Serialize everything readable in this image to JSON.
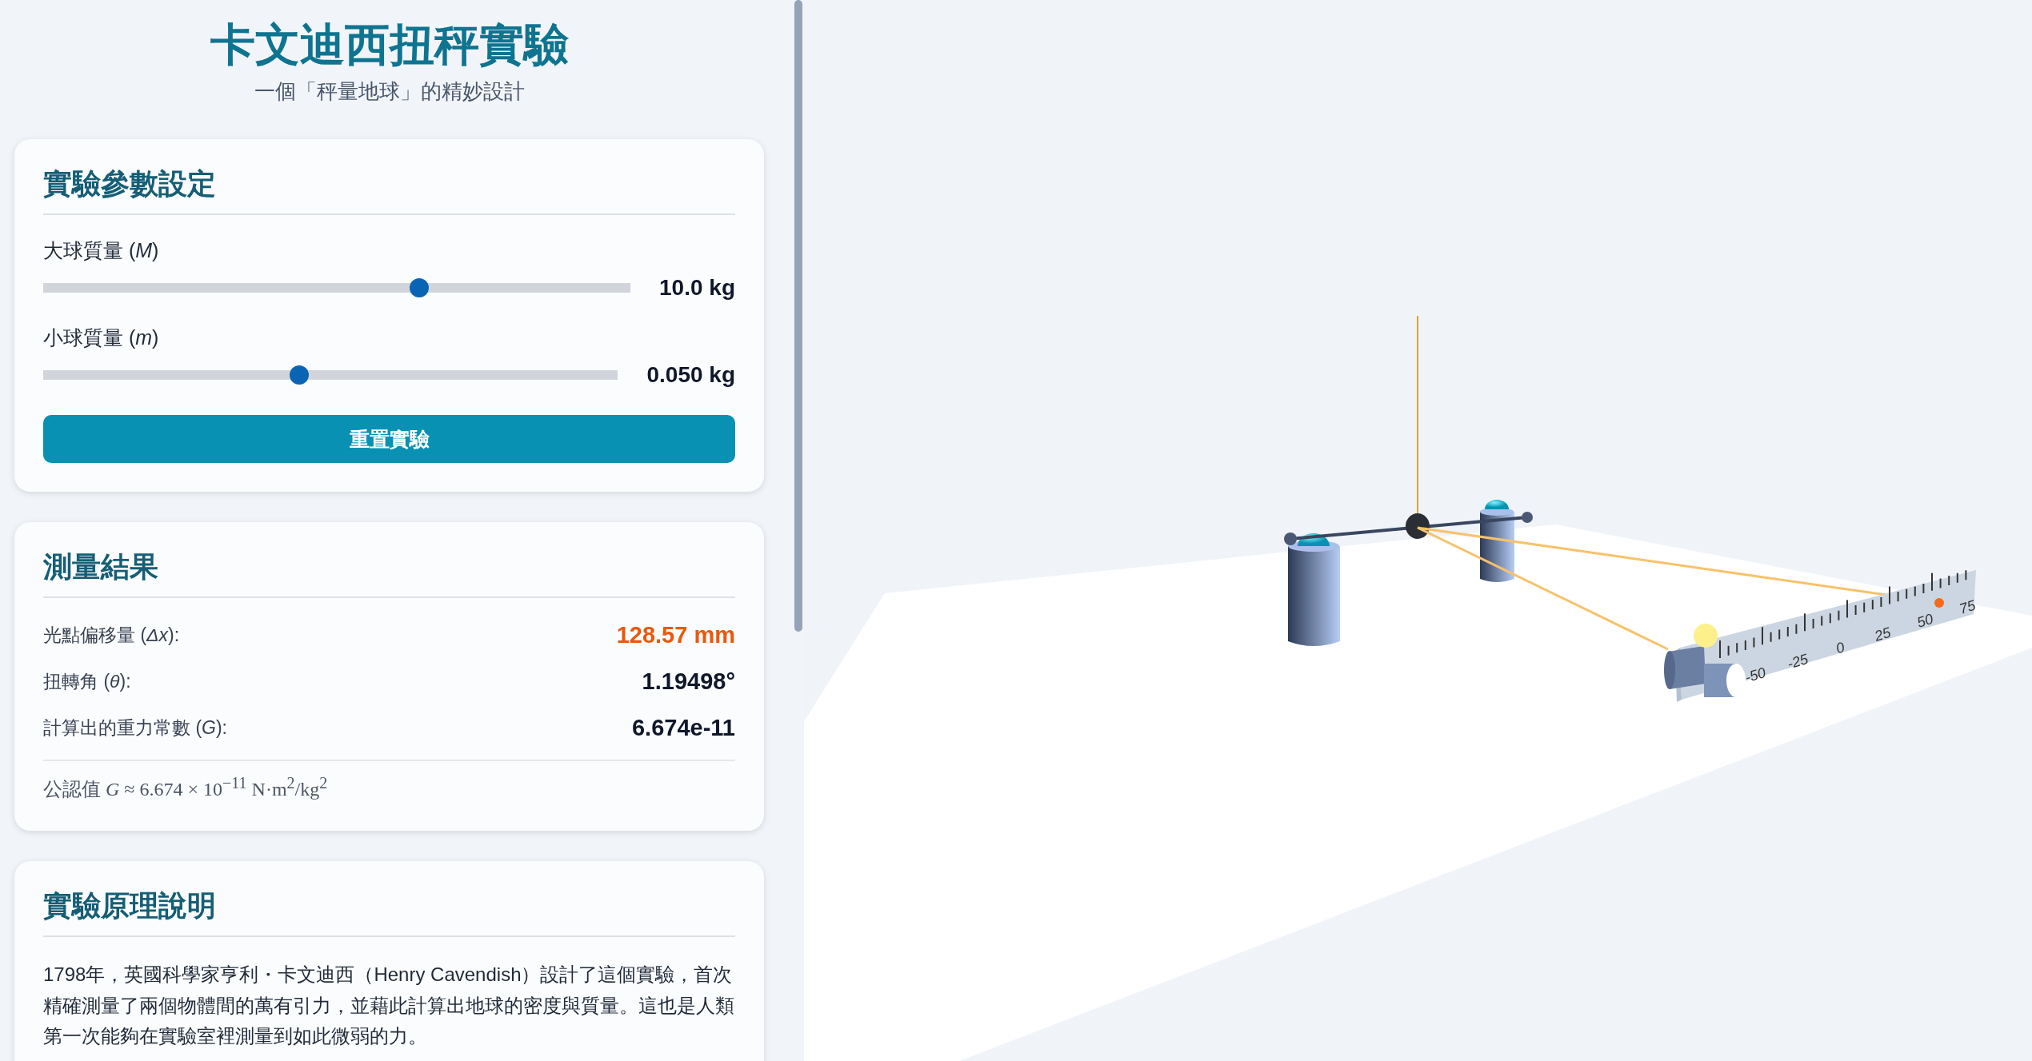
{
  "header": {
    "title": "卡文迪西扭秤實驗",
    "subtitle": "一個「秤量地球」的精妙設計"
  },
  "controls": {
    "heading": "實驗參數設定",
    "sliders": [
      {
        "label": "大球質量 (*M*)",
        "level": 0.64,
        "value": "10.0 kg"
      },
      {
        "label": "小球質量 (*m*)",
        "level": 0.445,
        "value": "0.050 kg"
      }
    ],
    "reset_button": "重置實驗"
  },
  "results": {
    "heading": "測量結果",
    "rows": [
      {
        "label": "光點偏移量 (*Δx*):",
        "value": "128.57 mm",
        "highlight": true
      },
      {
        "label": "扭轉角 (*θ*):",
        "value": "1.19498°",
        "highlight": false
      },
      {
        "label": "計算出的重力常數 (*G*):",
        "value": "6.674e-11",
        "highlight": false
      }
    ],
    "note": "公認值 *G* ≈ 6.674 × 10$^{−11}$ N·m$^{2}$/kg$^{2}$"
  },
  "explanation": {
    "heading": "實驗原理說明",
    "text": "1798年，英國科學家亨利・卡文迪西（Henry Cavendish）設計了這個實驗，首次精確測量了兩個物體間的萬有引力，並藉此計算出地球的密度與質量。這也是人類第一次能夠在實驗室裡測量到如此微弱的力。"
  },
  "scene": {
    "scale_labels": [
      "-50",
      "-25",
      "0",
      "25",
      "50",
      "75"
    ]
  }
}
